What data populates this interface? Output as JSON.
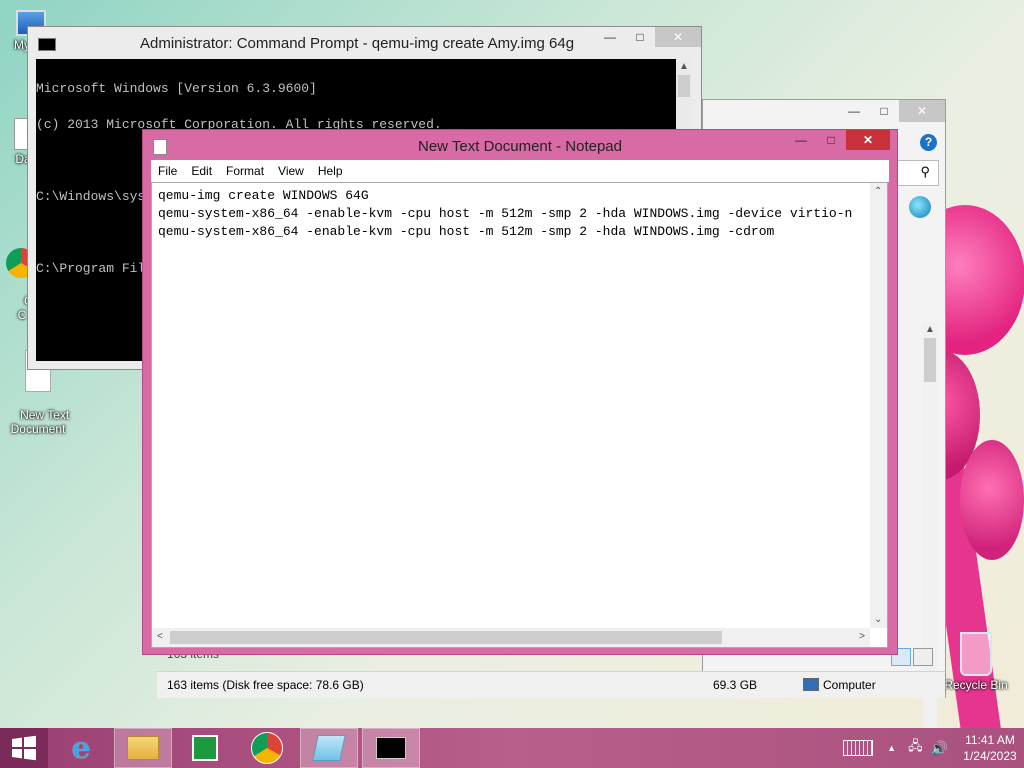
{
  "desktop": {
    "icons": [
      {
        "label": "My C",
        "icon": "computer-icon"
      },
      {
        "label": "Data",
        "icon": "data-icon"
      },
      {
        "label": "G\nC",
        "icon": "chrome-icon"
      },
      {
        "label": "New Text\nDocument",
        "icon": "text-document-icon"
      },
      {
        "label": "Recycle Bin",
        "icon": "recycle-bin-icon"
      }
    ]
  },
  "cmd": {
    "title": "Administrator:  Command Prompt - qemu-img  create Amy.img 64g",
    "lines": [
      "Microsoft Windows [Version 6.3.9600]",
      "(c) 2013 Microsoft Corporation. All rights reserved.",
      "",
      "C:\\Windows\\system32>cd C:\\Program Files\\qemu",
      "",
      "C:\\Program Files\\qemu>qemu-img create Amy.img 64g"
    ]
  },
  "explorer": {
    "items_count": "163 items",
    "status_left": "163 items (Disk free space: 78.6 GB)",
    "status_size": "69.3 GB",
    "status_location": "Computer"
  },
  "notepad": {
    "title": "New Text Document - Notepad",
    "menu": [
      "File",
      "Edit",
      "Format",
      "View",
      "Help"
    ],
    "content": "qemu-img create WINDOWS 64G\nqemu-system-x86_64 -enable-kvm -cpu host -m 512m -smp 2 -hda WINDOWS.img -device virtio-n\nqemu-system-x86_64 -enable-kvm -cpu host -m 512m -smp 2 -hda WINDOWS.img -cdrom"
  },
  "taskbar": {
    "time": "11:41 AM",
    "date": "1/24/2023",
    "apps": [
      "internet-explorer-icon",
      "file-explorer-icon",
      "store-icon",
      "chrome-icon",
      "notepad-icon",
      "command-prompt-icon"
    ]
  },
  "colors": {
    "notepad_frame": "#d86aa6",
    "close_red": "#c7323a",
    "taskbar": "#b95f8b"
  }
}
